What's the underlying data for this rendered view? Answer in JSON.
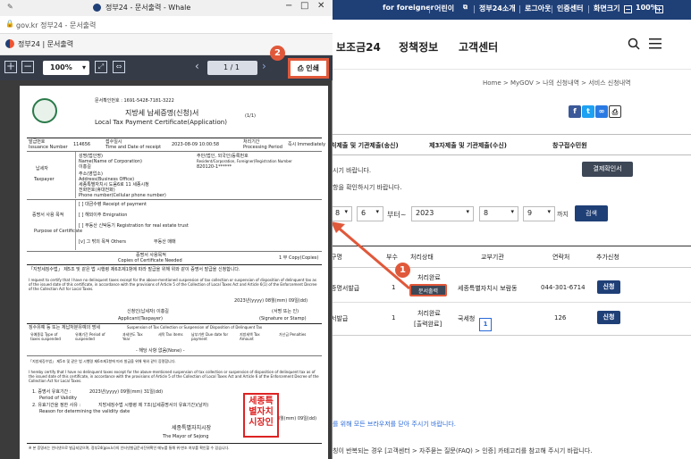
{
  "top_links": {
    "foreigner": "for foreigner",
    "kids": "어린이",
    "about": "정부24소개",
    "logout": "로그아웃",
    "cert": "인증센터",
    "zoom": "화면크기",
    "zoom_value": "100%"
  },
  "nav": {
    "menu1": "보조금24",
    "menu2": "정책정보",
    "menu3": "고객센터"
  },
  "breadcrumb": "Home > MyGOV > 나의 신청내역 > 서비스 신청내역",
  "tabs": {
    "t1": "처제출 및 기관제출(송신)",
    "t2": "제3자제출 및 기관제출(수신)",
    "t3": "창구접수민원"
  },
  "page": {
    "text1": "시기 바랍니다.",
    "text2": "항을 확인하시기 바랍니다.",
    "result_btn": "결제확인서",
    "bottom1": "를 위해 모든 브라우저를 닫아 주시기 바랍니다.",
    "bottom2": "칭이 반복되는 경우 [고객센터 > 자주묻는 질문(FAQ) > 인증] 카테고리를 참고해 주시기 바랍니다.",
    "page_num": "1"
  },
  "filter": {
    "from_month": "8",
    "from_day": "6",
    "to_label": "부터~",
    "to_year": "2023",
    "to_month": "8",
    "to_day": "9",
    "until": "까지",
    "search": "검색"
  },
  "table": {
    "h_name": "구명",
    "h_count": "부수",
    "h_status": "처리상태",
    "h_agency": "교부기관",
    "h_contact": "연락처",
    "h_extra": "추가신청",
    "r1_name": "증명서발급",
    "r1_count": "1",
    "r1_status": "처리완료",
    "r1_btn": "문서출력",
    "r1_agency": "세종특별자치시 보람동",
    "r1_contact": "044-301-6714",
    "r1_extra": "신청",
    "r2_name": "서발급",
    "r2_count": "1",
    "r2_status": "처리완료",
    "r2_status2": "[출력완료]",
    "r2_agency": "국세청",
    "r2_contact": "126",
    "r2_extra": "신청"
  },
  "popup": {
    "title": "정부24 - 문서출력 - Whale",
    "url": "gov.kr 정부24 - 문서출력",
    "doc_title": "정부24 | 문서출력",
    "zoom": "100%",
    "page": "1",
    "page_total": "/ 1",
    "print": "인쇄"
  },
  "badges": {
    "b1": "1",
    "b2": "2"
  },
  "doc": {
    "issue_no": "문서확인번호 : 1691-5428-7181-3222",
    "title_ko": "지방세 납세증명(신청)서",
    "title_en": "Local Tax Payment Certificate(Application)",
    "pages": "(1/1)",
    "h1": "발급번호",
    "h1v": "Issuance Number",
    "h1n": "114656",
    "h2": "접수일시",
    "h2v": "Time and Date of receipt",
    "h2n": "2023-08-09 10:00:58",
    "h3": "처리기간",
    "h3v": "Processing Period",
    "h3n": "즉시 Immediately",
    "tp_ko": "납세자",
    "tp_en": "Taxpayer",
    "tp1": "성명(법인명)",
    "tp1e": "Name(Name of Corporation)",
    "tp1n": "이홍길",
    "tp2": "주민(법인, 외국인)등록번호",
    "tp2e": "Resident/Corporation, Foreigner)Registration Number",
    "tp2n": "820120-1******",
    "tp3": "주소(영업소)",
    "tp3e": "Address(Business Office)",
    "tp3n": "세종특별자치시 도움6로 11 세종시청",
    "tp4": "전화번호(휴대전화)",
    "tp4e": "Phone number(Cellular phone number)",
    "tp4n": "010-0000-0000",
    "pu_ko": "증명서 사용 목적",
    "pu_en": "Purpose of Certificate",
    "pu1": "[ ] 대금수령 Receipt of payment",
    "pu2": "[ ] 해외이주 Emigration",
    "pu3": "[ ] 부동산 신탁등기 Registration for real estate trust",
    "pu4": "[v] 그 밖의 목적 Others",
    "pu5": "부동산 매매",
    "copies": "증명서 사용목적",
    "copies_e": "Copies of Certificate Needed",
    "copies_n": "1 부 Copy(Copies)",
    "cert_ko": "「지방세징수법」 제5조 및 같은 법 시행령 제6조제1항에 따라 발급을 위해 위와 같이 증명서 발급을 신청합니다.",
    "cert_en": "I request to certify that I have no delinquent taxes except for the above-mentioned suspension of tax collection or suspension of disposition of delinquent tax as of the issued date of this certificate, in accordance with the provisions of Article 5 of the Collection of Local Taxes Act and Article 6(1) of the Enforcement Decree of the Collection Act for Local Taxes.",
    "date1": "2023년(yyyy) 08월(mm) 09일(dd)",
    "applicant": "신청인(납세자)  이홍길",
    "applicant_e": "Applicant(Taxpayer)",
    "sign": "(서명 또는 인)",
    "sign_e": "(Signature or Stamp)",
    "sus_title": "징수유예 등 또는 체납처분유예의 명세",
    "sus_title_e": "Suspension of Tax Collection or Suspension of Disposition of Delinquent Tax",
    "sus_c1": "유예종류 Type of taxes suspended",
    "sus_c2": "유예기간 Period of suspended",
    "sus_c3": "과세연도 Tax Year",
    "sus_c4": "세목 Tax items",
    "sus_c5": "납부기한 Due date for payment",
    "sus_c6": "지방세액 Tax Amount",
    "sus_c7": "가산금 Penalties",
    "none": "- 해당 사항 없음(None) -",
    "cert2_ko": "「지방세징수법」 제5조 및 같은 법 시행령 제6조제1항에 따라 발급을 위해 위와 같이 증명합니다.",
    "cert2_en": "I hereby certify that I have no delinquent taxes except for the above-mentioned suspension of tax collection or suspension of disposition of delinquent tax as of the issued date of this certificate, in accordance with the provisions of Article 5 of the Collection of Local Taxes Act and Article 6 of the Enforcement Decree of the Collection Act for Local Taxes.",
    "v1": "1. 증명서 유효기간 :",
    "v1n": "2023년(yyyy) 09월(mm) 31일(dd)",
    "v1e": "Period of Validity",
    "v2": "2. 유효기간을 정한 사유 :",
    "v2n": "지방세징수법 시행령 제 7조(납세증명서의 유효기간)(날자)",
    "v2e": "Reason for determining the validity date",
    "date2": "2023년(yyyy) 08월(mm) 09일(dd)",
    "mayor": "세종특별자치시장",
    "mayor_e": "The Mayor of Sejong",
    "seal": "세종특\n별자치\n시장인",
    "footer": "※ 본 증명서는 인터넷으로 발급되었으며, 정부24(gov.kr)의 인터넷발급문서진위확인 메뉴를 통해 위·변조 여부를 확인할 수 있습니다."
  }
}
